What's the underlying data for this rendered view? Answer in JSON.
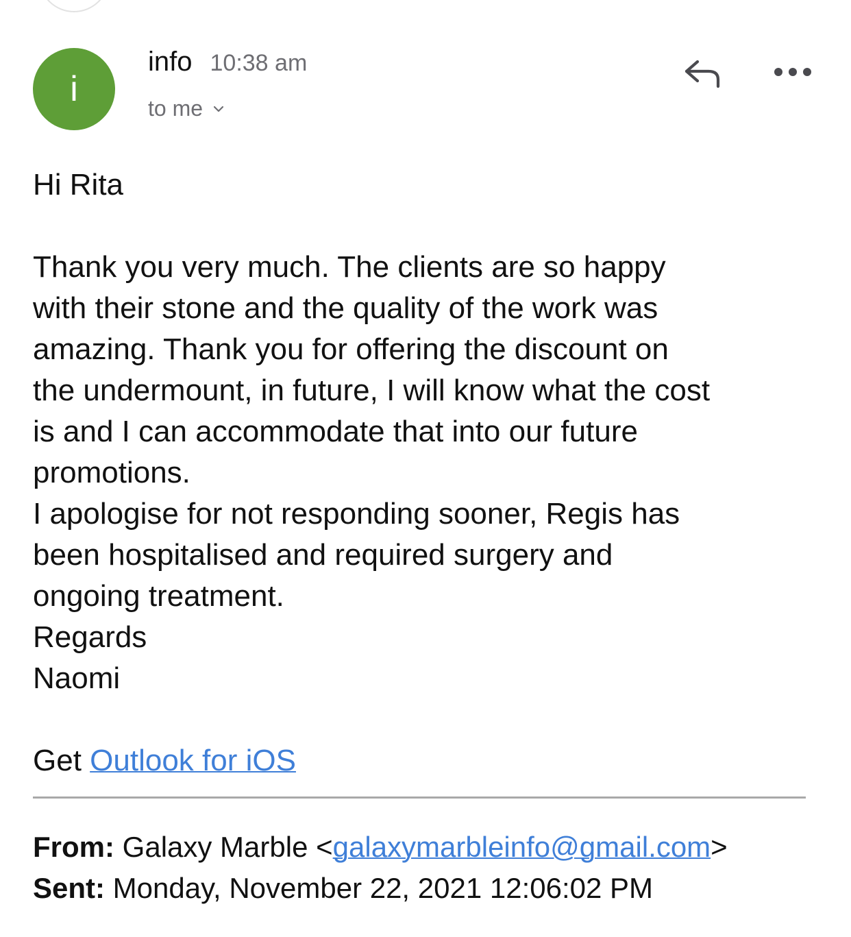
{
  "header": {
    "avatar_letter": "i",
    "avatar_color": "#5e9e37",
    "sender_name": "info",
    "time": "10:38 am",
    "recipient": "to me",
    "reply_icon": "reply-icon",
    "more_icon": "more-icon"
  },
  "message": {
    "greeting": "Hi Rita",
    "paragraph_lines": [
      "Thank you very much. The clients are so happy",
      "with their stone and the quality of the work was",
      "amazing. Thank you for offering the discount on",
      "the undermount, in future, I will know what the cost",
      "is and I can accommodate that into our future",
      "promotions.",
      "I apologise for not responding sooner, Regis has",
      "been hospitalised and required surgery and",
      "ongoing treatment.",
      "Regards",
      "Naomi"
    ],
    "signature_prefix": "Get ",
    "signature_link": "Outlook for iOS"
  },
  "quoted": {
    "from_label": "From:",
    "from_name": "Galaxy Marble <",
    "from_email": "galaxymarbleinfo@gmail.com",
    "from_suffix": ">",
    "sent_label": "Sent:",
    "sent_value": "Monday, November 22, 2021 12:06:02 PM"
  },
  "colors": {
    "link": "#3f7fd8",
    "secondary_text": "#6e6e73"
  }
}
